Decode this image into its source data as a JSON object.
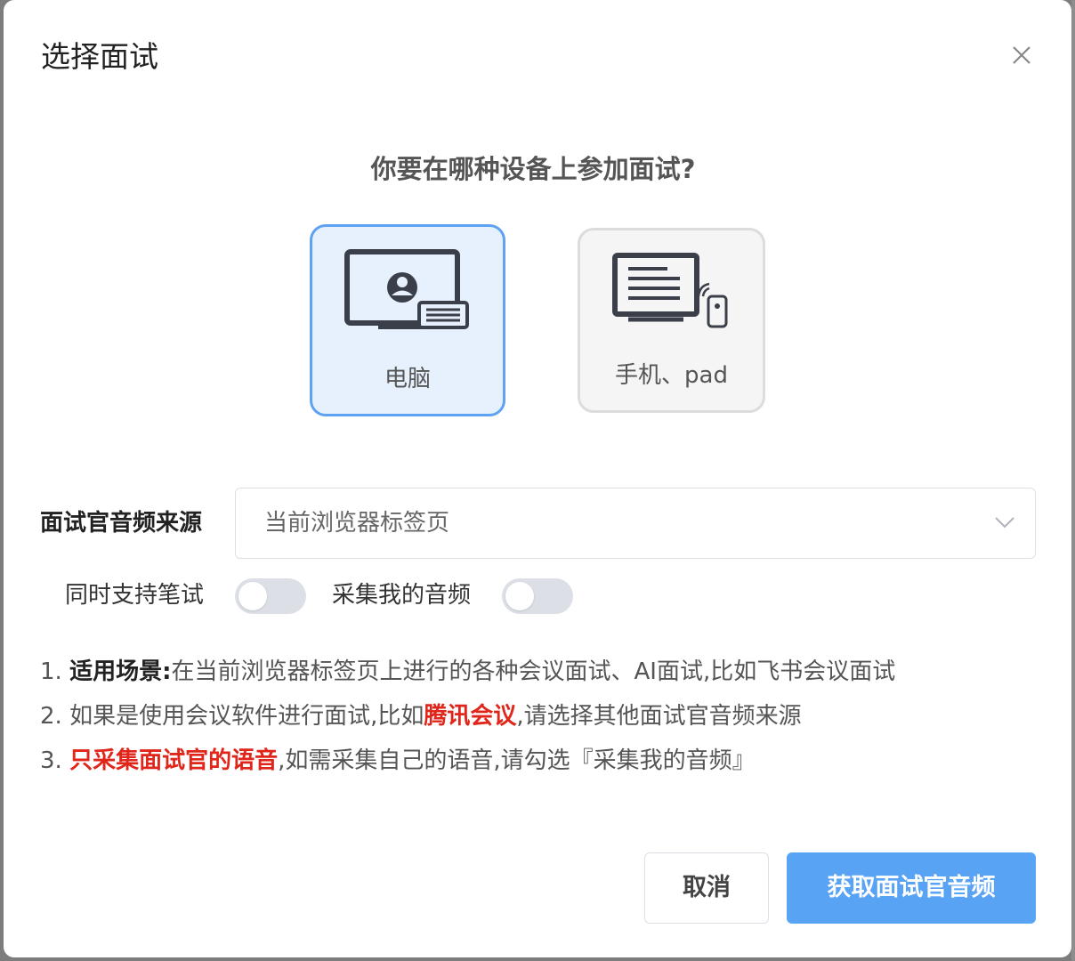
{
  "dialog": {
    "title": "选择面试",
    "question": "你要在哪种设备上参加面试?"
  },
  "devices": [
    {
      "label": "电脑",
      "selected": true
    },
    {
      "label": "手机、pad",
      "selected": false
    }
  ],
  "audio_source": {
    "label": "面试官音频来源",
    "value": "当前浏览器标签页"
  },
  "options": {
    "written_test_label": "同时支持笔试",
    "written_test_on": false,
    "record_my_audio_label": "采集我的音频",
    "record_my_audio_on": false
  },
  "notes": {
    "n1_prefix": "1. ",
    "n1_strong": "适用场景:",
    "n1_text": "在当前浏览器标签页上进行的各种会议面试、AI面试,比如飞书会议面试",
    "n2_prefix": "2. 如果是使用会议软件进行面试,比如",
    "n2_red": "腾讯会议",
    "n2_suffix": ",请选择其他面试官音频来源",
    "n3_prefix": "3. ",
    "n3_red": "只采集面试官的语音",
    "n3_suffix": ",如需采集自己的语音,请勾选『采集我的音频』"
  },
  "buttons": {
    "cancel": "取消",
    "primary": "获取面试官音频"
  },
  "colors": {
    "accent": "#59a3f5",
    "selected_border": "#5fa2f2",
    "selected_bg": "#e6f1fd",
    "highlight_red": "#e0251b"
  }
}
